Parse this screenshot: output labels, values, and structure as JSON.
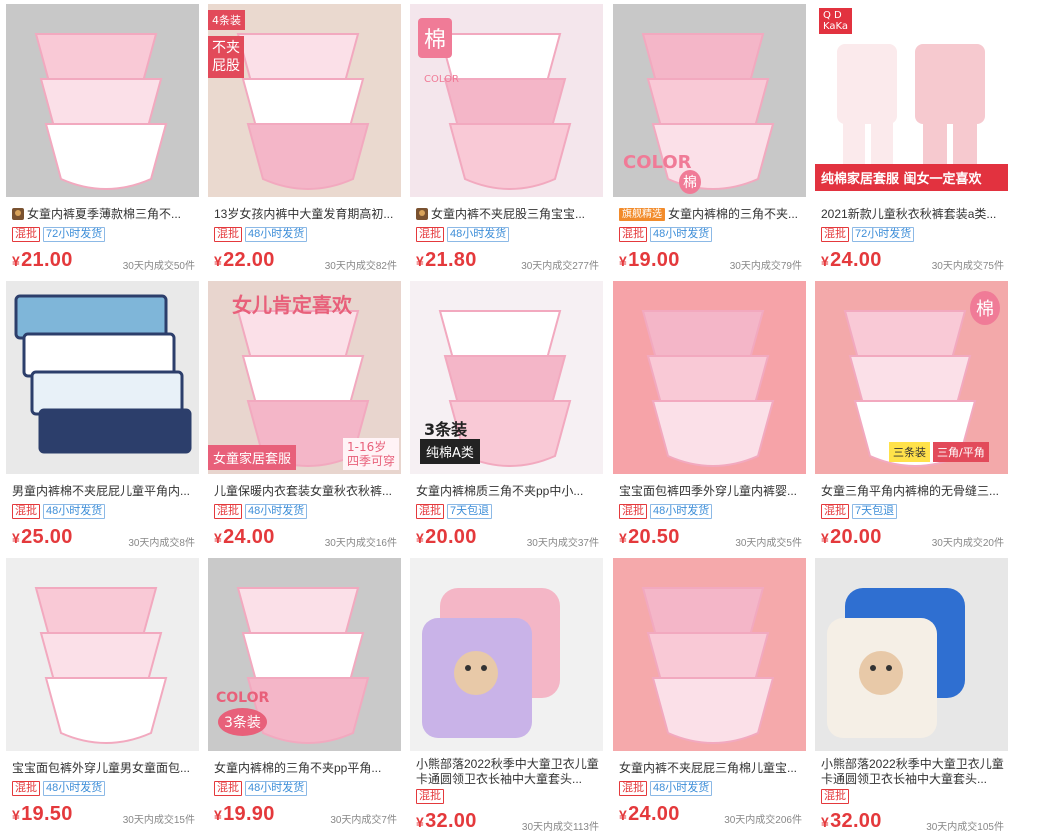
{
  "products": [
    {
      "title": "女童内裤夏季薄款棉三角不...",
      "shop_icon": true,
      "mix_label": "混批",
      "ship_label": "72小时发货",
      "price": "21.00",
      "sales": "30天内成交50件",
      "overlay": ""
    },
    {
      "title": "13岁女孩内裤中大童发育期高初...",
      "mix_label": "混批",
      "ship_label": "48小时发货",
      "price": "22.00",
      "sales": "30天内成交82件",
      "overlay": "4条装 不夹屁股"
    },
    {
      "title": "女童内裤不夹屁股三角宝宝...",
      "shop_icon": true,
      "mix_label": "混批",
      "ship_label": "48小时发货",
      "price": "21.80",
      "sales": "30天内成交277件",
      "overlay": "棉 COLOR"
    },
    {
      "title": "女童内裤棉的三角不夹...",
      "tag_inline": "旗舰精选",
      "mix_label": "混批",
      "ship_label": "48小时发货",
      "price": "19.00",
      "sales": "30天内成交79件",
      "overlay": "COLOR 棉"
    },
    {
      "title": "2021新款儿童秋衣秋裤套装a类...",
      "mix_label": "混批",
      "ship_label": "72小时发货",
      "price": "24.00",
      "sales": "30天内成交75件",
      "overlay": "纯棉家居套服 闺女一定喜欢"
    },
    {
      "title": "男童内裤棉不夹屁屁儿童平角内...",
      "mix_label": "混批",
      "ship_label": "48小时发货",
      "price": "25.00",
      "sales": "30天内成交8件",
      "overlay": ""
    },
    {
      "title": "儿童保暖内衣套装女童秋衣秋裤...",
      "mix_label": "混批",
      "ship_label": "48小时发货",
      "price": "24.00",
      "sales": "30天内成交16件",
      "overlay": "女儿肯定喜欢 女童家居套服 1-16岁 四季可穿"
    },
    {
      "title": "女童内裤棉质三角不夹pp中小...",
      "mix_label": "混批",
      "ship_label": "7天包退",
      "price": "20.00",
      "sales": "30天内成交37件",
      "overlay": "3条装 纯棉A类"
    },
    {
      "title": "宝宝面包裤四季外穿儿童内裤婴...",
      "mix_label": "混批",
      "ship_label": "48小时发货",
      "price": "20.50",
      "sales": "30天内成交5件",
      "overlay": ""
    },
    {
      "title": "女童三角平角内裤棉的无骨缝三...",
      "mix_label": "混批",
      "ship_label": "7天包退",
      "price": "20.00",
      "sales": "30天内成交20件",
      "overlay": "棉 三条装 三角/平角"
    },
    {
      "title": "宝宝面包裤外穿儿童男女童面包...",
      "mix_label": "混批",
      "ship_label": "48小时发货",
      "price": "19.50",
      "sales": "30天内成交15件",
      "overlay": ""
    },
    {
      "title": "女童内裤棉的三角不夹pp平角...",
      "mix_label": "混批",
      "ship_label": "48小时发货",
      "price": "19.90",
      "sales": "30天内成交7件",
      "overlay": "COLOR 3条装"
    },
    {
      "title": "小熊部落2022秋季中大童卫衣儿童卡通圆领卫衣长袖中大童套头...",
      "two_line": true,
      "mix_label": "混批",
      "ship_label": "",
      "price": "32.00",
      "sales": "30天内成交113件",
      "overlay": ""
    },
    {
      "title": "女童内裤不夹屁屁三角棉儿童宝...",
      "mix_label": "混批",
      "ship_label": "48小时发货",
      "price": "24.00",
      "sales": "30天内成交206件",
      "overlay": ""
    },
    {
      "title": "小熊部落2022秋季中大童卫衣儿童卡通圆领卫衣长袖中大童套头...",
      "two_line": true,
      "mix_label": "混批",
      "ship_label": "",
      "price": "32.00",
      "sales": "30天内成交105件",
      "overlay": ""
    }
  ],
  "currency_symbol": "¥",
  "colors": {
    "price": "#e4393c",
    "mix_badge": "#e4393c",
    "ship_badge": "#3d8ed8"
  }
}
